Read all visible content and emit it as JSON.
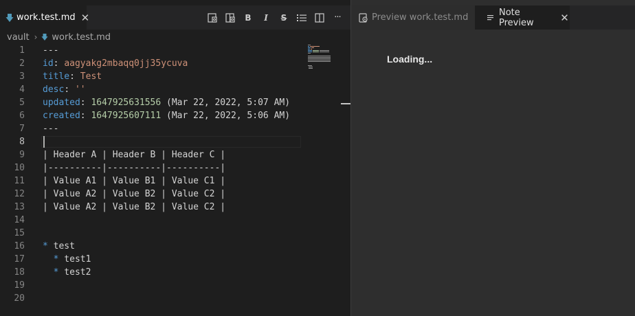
{
  "left_tab": {
    "label": "work.test.md",
    "icon": "markdown-arrow-icon"
  },
  "toolbar": {
    "icons": [
      "open-preview-side-icon",
      "open-preview-icon",
      "bold-icon",
      "italic-icon",
      "strikethrough-icon",
      "bullet-list-icon",
      "split-editor-icon",
      "more-actions-icon"
    ],
    "bold": "B",
    "italic": "I",
    "strike": "S",
    "more": "···"
  },
  "breadcrumb": {
    "root": "vault",
    "file": "work.test.md"
  },
  "editor": {
    "lines": [
      {
        "n": "1",
        "parts": [
          [
            "",
            "---"
          ]
        ]
      },
      {
        "n": "2",
        "parts": [
          [
            "key",
            "id"
          ],
          [
            "",
            ": "
          ],
          [
            "strv",
            "aagyakg2mbaqq0jj35ycuva"
          ]
        ]
      },
      {
        "n": "3",
        "parts": [
          [
            "key",
            "title"
          ],
          [
            "",
            ": "
          ],
          [
            "strv",
            "Test"
          ]
        ]
      },
      {
        "n": "4",
        "parts": [
          [
            "key",
            "desc"
          ],
          [
            "",
            ": "
          ],
          [
            "strv",
            "''"
          ]
        ]
      },
      {
        "n": "5",
        "parts": [
          [
            "key",
            "updated"
          ],
          [
            "",
            ": "
          ],
          [
            "numv",
            "1647925631556"
          ],
          [
            "",
            " (Mar 22, 2022, 5:07 AM)"
          ]
        ]
      },
      {
        "n": "6",
        "parts": [
          [
            "key",
            "created"
          ],
          [
            "",
            ": "
          ],
          [
            "numv",
            "1647925607111"
          ],
          [
            "",
            " (Mar 22, 2022, 5:06 AM)"
          ]
        ]
      },
      {
        "n": "7",
        "parts": [
          [
            "",
            "---"
          ]
        ]
      },
      {
        "n": "8",
        "parts": [],
        "current": true
      },
      {
        "n": "9",
        "parts": [
          [
            "",
            "| Header A | Header B | Header C |"
          ]
        ]
      },
      {
        "n": "10",
        "parts": [
          [
            "",
            "|----------|----------|----------|"
          ]
        ]
      },
      {
        "n": "11",
        "parts": [
          [
            "",
            "| Value A1 | Value B1 | Value C1 |"
          ]
        ]
      },
      {
        "n": "12",
        "parts": [
          [
            "",
            "| Value A2 | Value B2 | Value C2 |"
          ]
        ]
      },
      {
        "n": "13",
        "parts": [
          [
            "",
            "| Value A2 | Value B2 | Value C2 |"
          ]
        ]
      },
      {
        "n": "14",
        "parts": []
      },
      {
        "n": "15",
        "parts": []
      },
      {
        "n": "16",
        "parts": [
          [
            "bul",
            "*"
          ],
          [
            "",
            " test"
          ]
        ]
      },
      {
        "n": "17",
        "parts": [
          [
            "",
            "  "
          ],
          [
            "bul",
            "*"
          ],
          [
            "",
            " test1"
          ]
        ]
      },
      {
        "n": "18",
        "parts": [
          [
            "",
            "  "
          ],
          [
            "bul",
            "*"
          ],
          [
            "",
            " test2"
          ]
        ]
      },
      {
        "n": "19",
        "parts": []
      },
      {
        "n": "20",
        "parts": []
      }
    ]
  },
  "right_tabs": [
    {
      "label": "Preview work.test.md",
      "icon": "preview-icon",
      "active": false
    },
    {
      "label": "Note Preview",
      "icon": "note-preview-icon",
      "active": true
    }
  ],
  "right_tab_close": "✕",
  "left_tab_close": "✕",
  "preview": {
    "status": "Loading..."
  }
}
